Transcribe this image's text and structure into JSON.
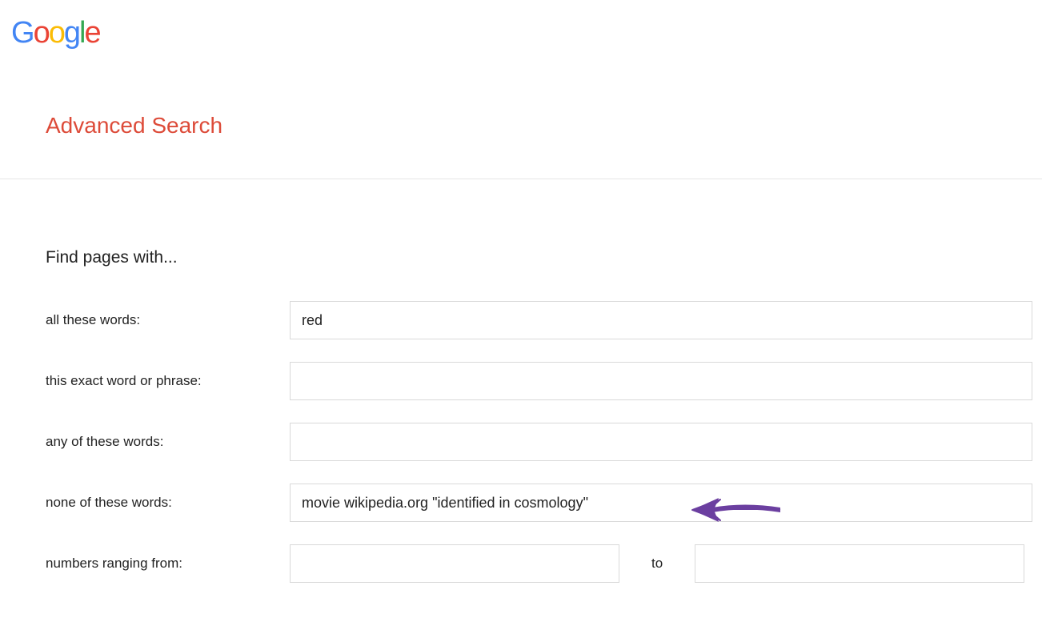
{
  "logo": {
    "g1": "G",
    "o1": "o",
    "o2": "o",
    "g2": "g",
    "l": "l",
    "e": "e"
  },
  "page": {
    "title": "Advanced Search"
  },
  "form": {
    "heading": "Find pages with...",
    "fields": {
      "all_words": {
        "label": "all these words:",
        "value": "red"
      },
      "exact_phrase": {
        "label": "this exact word or phrase:",
        "value": ""
      },
      "any_words": {
        "label": "any of these words:",
        "value": ""
      },
      "none_words": {
        "label": "none of these words:",
        "value": "movie wikipedia.org \"identified in cosmology\""
      },
      "numbers_from": {
        "label": "numbers ranging from:",
        "value": ""
      },
      "numbers_to": {
        "to_label": "to",
        "value": ""
      }
    }
  },
  "annotation": {
    "arrow_color": "#6B3FA0"
  }
}
